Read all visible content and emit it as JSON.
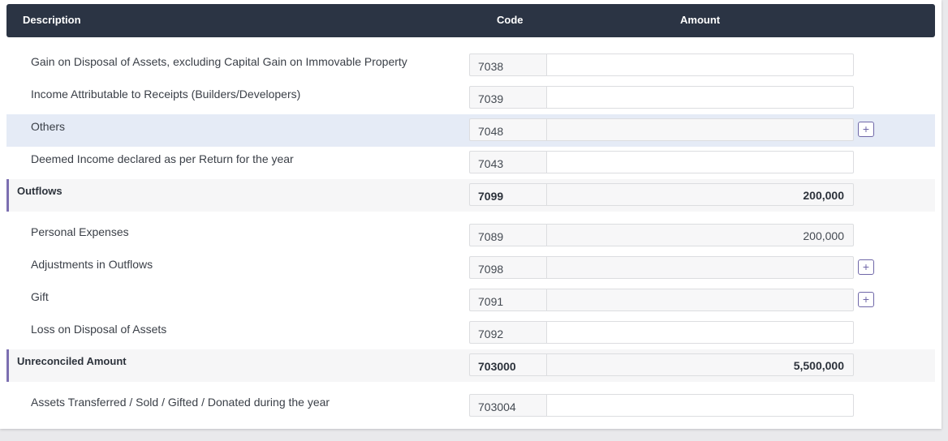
{
  "header": {
    "description": "Description",
    "code": "Code",
    "amount": "Amount"
  },
  "rows": [
    {
      "label": "Gain on Disposal of Assets, excluding Capital Gain on Immovable Property",
      "code": "7038",
      "amount": ""
    },
    {
      "label": "Income Attributable to Receipts (Builders/Developers)",
      "code": "7039",
      "amount": ""
    },
    {
      "label": "Others",
      "code": "7048",
      "amount": "",
      "add_button": "+"
    },
    {
      "label": "Deemed Income declared as per Return for the year",
      "code": "7043",
      "amount": ""
    },
    {
      "label": "Outflows",
      "code": "7099",
      "amount": "200,000"
    },
    {
      "label": "Personal Expenses",
      "code": "7089",
      "amount": "200,000"
    },
    {
      "label": "Adjustments in Outflows",
      "code": "7098",
      "amount": "",
      "add_button": "+"
    },
    {
      "label": "Gift",
      "code": "7091",
      "amount": "",
      "add_button": "+"
    },
    {
      "label": "Loss on Disposal of Assets",
      "code": "7092",
      "amount": ""
    },
    {
      "label": "Unreconciled Amount",
      "code": "703000",
      "amount": "5,500,000"
    },
    {
      "label": "Assets Transferred / Sold / Gifted / Donated during the year",
      "code": "703004",
      "amount": ""
    }
  ],
  "colors": {
    "header_bg": "#2b3444",
    "highlight_row": "#e5ebf6",
    "section_accent": "#7c6fb1",
    "button_accent": "#6f67a8"
  }
}
